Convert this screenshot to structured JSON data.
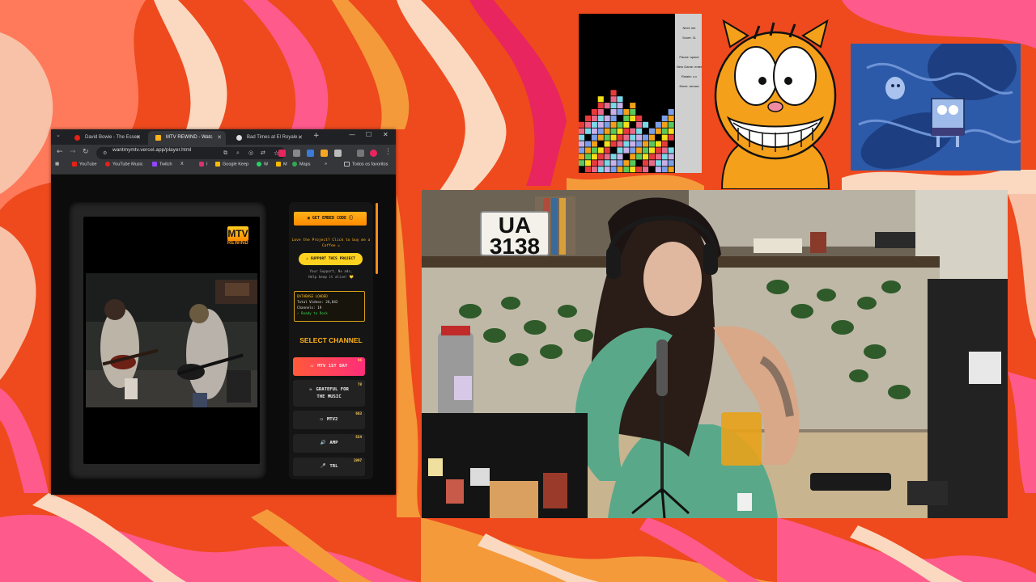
{
  "browser": {
    "tabs": [
      {
        "label": "David Bowie - The Essen"
      },
      {
        "label": "MTV REWIND - Watc"
      },
      {
        "label": "Bad Times at El Royale - "
      }
    ],
    "url": "wantmymtv.vercel.app/player.html",
    "bookmarks": [
      "YouTube",
      "YouTube Music",
      "Twitch",
      "X",
      "I",
      "Google Keep",
      "W",
      "M",
      "Maps",
      "Todos os favoritos"
    ]
  },
  "player": {
    "logo_text": "MTV",
    "logo_sub": "REWIND",
    "embed_button": "GET EMBED CODE",
    "love_text": "Love the Project? Click to buy me a Coffee ☕",
    "support_button": "SUPPORT THIS PROJECT",
    "note_line1": "Your Support, No ads,",
    "note_line2": "Help keep it alive! 💛",
    "db_title": "DATABASE LOADED",
    "db_videos": "Total Videos: 26,842",
    "db_channels": "Channels: 19",
    "db_ready": "✓ Ready to Rock",
    "select_channel": "SELECT CHANNEL",
    "channels": [
      {
        "label": "MTV 1ST DAY",
        "count": "96",
        "icon": "tv-icon"
      },
      {
        "label": "GRATEFUL FOR THE MUSIC",
        "label1": "GRATEFUL FOR",
        "label2": "THE MUSIC",
        "count": "78",
        "icon": "skull-icon"
      },
      {
        "label": "MTV2",
        "count": "603",
        "icon": "tv-icon"
      },
      {
        "label": "AMP",
        "count": "554",
        "icon": "speaker-icon"
      },
      {
        "label": "TRL",
        "count": "1997",
        "icon": "mic-icon"
      }
    ]
  },
  "tetris": {
    "next": "Next: me",
    "score": "Score: 11",
    "pause": "Pause: space",
    "new_game": "New Game: enter",
    "rotate": "Rotate: z,x",
    "move": "Move: arrows"
  },
  "webcam": {
    "plate_line1": "UA",
    "plate_line2": "3138"
  }
}
